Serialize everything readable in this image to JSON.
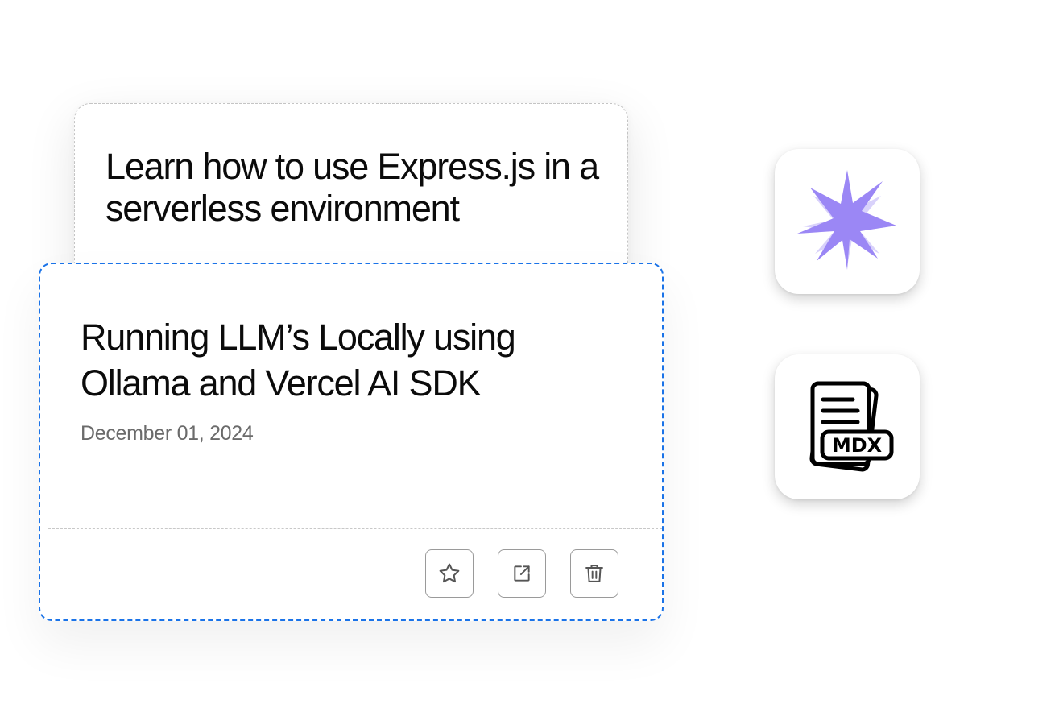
{
  "cards": {
    "back": {
      "title": "Learn how to use Express.js in a serverless environment"
    },
    "front": {
      "title": "Running LLM’s Locally using Ollama and Vercel AI SDK",
      "date": "December 01, 2024"
    }
  },
  "actions": [
    {
      "name": "favorite",
      "icon": "star-icon"
    },
    {
      "name": "open-external",
      "icon": "external-link-icon"
    },
    {
      "name": "delete",
      "icon": "trash-icon"
    }
  ],
  "tiles": {
    "star": {
      "icon": "sparkle-star-icon",
      "color": "#9b87f5"
    },
    "mdx": {
      "icon": "mdx-file-icon",
      "label": "MDX"
    }
  },
  "colors": {
    "selection_border": "#1a73e8",
    "title_text": "#0b0b0b",
    "date_text": "#6b6b6b",
    "star_primary": "#9b87f5",
    "star_secondary": "#d9d2fb"
  }
}
